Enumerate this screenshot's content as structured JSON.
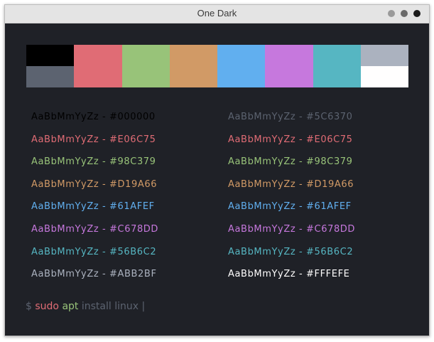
{
  "window": {
    "title": "One Dark",
    "bg": "#1f2127"
  },
  "palette": [
    {
      "normal": "#000000",
      "bright": "#5C6370"
    },
    {
      "normal": "#E06C75",
      "bright": "#E06C75"
    },
    {
      "normal": "#98C379",
      "bright": "#98C379"
    },
    {
      "normal": "#D19A66",
      "bright": "#D19A66"
    },
    {
      "normal": "#61AFEF",
      "bright": "#61AFEF"
    },
    {
      "normal": "#C678DD",
      "bright": "#C678DD"
    },
    {
      "normal": "#56B6C2",
      "bright": "#56B6C2"
    },
    {
      "normal": "#ABB2BF",
      "bright": "#FFFEFE"
    }
  ],
  "samples": {
    "left": [
      {
        "text": "AaBbMmYyZz - #000000",
        "color": "#000000"
      },
      {
        "text": "AaBbMmYyZz - #E06C75",
        "color": "#E06C75"
      },
      {
        "text": "AaBbMmYyZz - #98C379",
        "color": "#98C379"
      },
      {
        "text": "AaBbMmYyZz - #D19A66",
        "color": "#D19A66"
      },
      {
        "text": "AaBbMmYyZz - #61AFEF",
        "color": "#61AFEF"
      },
      {
        "text": "AaBbMmYyZz - #C678DD",
        "color": "#C678DD"
      },
      {
        "text": "AaBbMmYyZz - #56B6C2",
        "color": "#56B6C2"
      },
      {
        "text": "AaBbMmYyZz - #ABB2BF",
        "color": "#ABB2BF"
      }
    ],
    "right": [
      {
        "text": "AaBbMmYyZz - #5C6370",
        "color": "#5C6370"
      },
      {
        "text": "AaBbMmYyZz - #E06C75",
        "color": "#E06C75"
      },
      {
        "text": "AaBbMmYyZz - #98C379",
        "color": "#98C379"
      },
      {
        "text": "AaBbMmYyZz - #D19A66",
        "color": "#D19A66"
      },
      {
        "text": "AaBbMmYyZz - #61AFEF",
        "color": "#61AFEF"
      },
      {
        "text": "AaBbMmYyZz - #C678DD",
        "color": "#C678DD"
      },
      {
        "text": "AaBbMmYyZz - #56B6C2",
        "color": "#56B6C2"
      },
      {
        "text": "AaBbMmYyZz - #FFFEFE",
        "color": "#FFFEFE"
      }
    ]
  },
  "terminal": {
    "prompt_symbol": "$",
    "command": "sudo",
    "subcommand": "apt",
    "args": "install linux",
    "cursor": "|",
    "prompt_color": "#5C6370",
    "command_color": "#E06C75",
    "subcommand_color": "#98C379",
    "args_color": "#5C6370"
  }
}
